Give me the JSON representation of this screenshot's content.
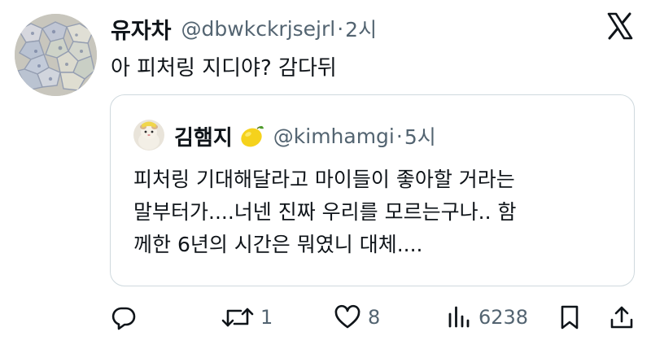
{
  "tweet": {
    "display_name": "유자차",
    "handle": "@dbwkckrjsejrl",
    "separator": "·",
    "time": "2시",
    "text": "아 피처링 지디야? 감다뒤"
  },
  "quote": {
    "display_name": "김햄지",
    "emoji": "lemon-emoji",
    "handle": "@kimhamgi",
    "separator": "·",
    "time": "5시",
    "lines": [
      "피처링 기대해달라고 마이들이 좋아할 거라는",
      "말부터가....너넨 진짜 우리를 모르는구나.. 함",
      "께한 6년의 시간은 뭐였니 대체...."
    ]
  },
  "actions": {
    "reply_count": "",
    "retweet_count": "1",
    "like_count": "8",
    "views_count": "6238"
  },
  "colors": {
    "text": "#0f1419",
    "secondary": "#536471",
    "border": "#cfd9de"
  }
}
